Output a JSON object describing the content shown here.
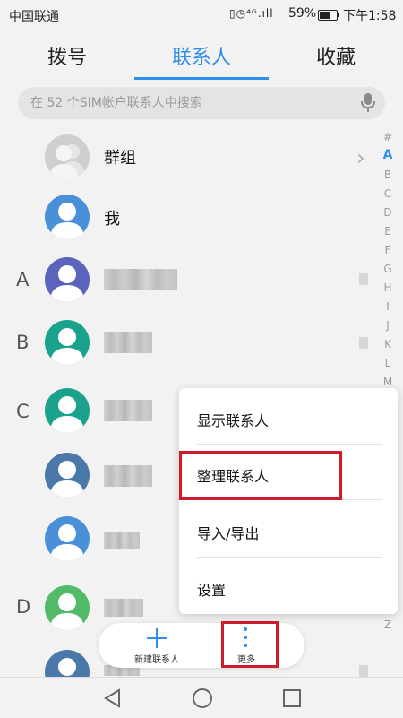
{
  "status_bar": {
    "carrier": "中国联通",
    "icons_text": "▯◷⁴ᴳ.ıll",
    "battery_percent": "59%",
    "time": "下午1:58"
  },
  "tabs": [
    {
      "label": "拨号",
      "active": false
    },
    {
      "label": "联系人",
      "active": true
    },
    {
      "label": "收藏",
      "active": false
    }
  ],
  "search": {
    "placeholder": "在 52 个SIM帐户联系人中搜索"
  },
  "contacts": {
    "group_label": "群组",
    "me_label": "我",
    "section_letters": [
      "A",
      "B",
      "C",
      "D"
    ]
  },
  "index_letters": [
    "#",
    "A",
    "B",
    "C",
    "D",
    "E",
    "F",
    "G",
    "H",
    "I",
    "J",
    "K",
    "L",
    "M",
    "Z"
  ],
  "menu": {
    "items": [
      "显示联系人",
      "整理联系人",
      "导入/导出",
      "设置"
    ]
  },
  "bottom_bar": {
    "new_contact_label": "新建联系人",
    "more_label": "更多"
  },
  "colors": {
    "accent": "#2e8ff0",
    "highlight": "#cc1c2b"
  }
}
